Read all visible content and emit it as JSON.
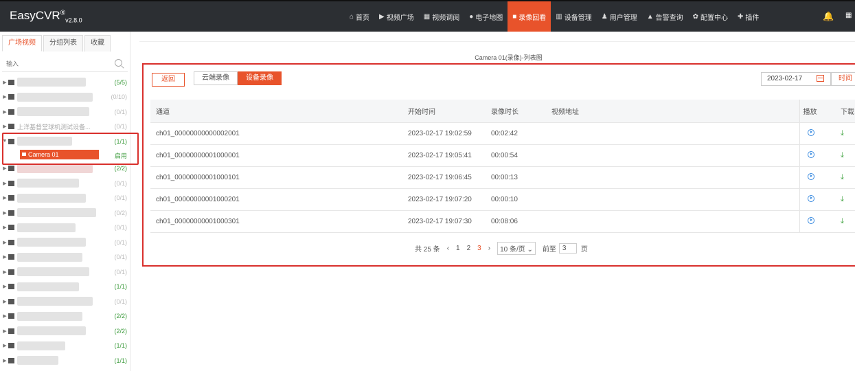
{
  "app": {
    "logo": "EasyCVR",
    "logo_sup": "®",
    "logo_version": "v2.8.0"
  },
  "nav": [
    {
      "label": "首页",
      "icon": "⌂"
    },
    {
      "label": "视频广场",
      "icon": "▶"
    },
    {
      "label": "视频调阅",
      "icon": "▦"
    },
    {
      "label": "电子地图",
      "icon": "●"
    },
    {
      "label": "录像回看",
      "icon": "■"
    },
    {
      "label": "设备管理",
      "icon": "▥"
    },
    {
      "label": "用户管理",
      "icon": "♟"
    },
    {
      "label": "告警查询",
      "icon": "▲"
    },
    {
      "label": "配置中心",
      "icon": "✿"
    },
    {
      "label": "插件",
      "icon": "✚"
    }
  ],
  "left": {
    "tabs": [
      "广场视频",
      "分组列表",
      "收藏"
    ],
    "search_placeholder": "输入",
    "tree_counts": [
      "(5/5)",
      "(0/10)",
      "(0/1)",
      "(0/1)",
      "(1/1)"
    ],
    "row4_name": "上洋基督堂球机测试设备...",
    "camera_name": "Camera 01",
    "camera_status": "启用",
    "tree_counts_after": [
      "(2/2)",
      "(0/1)",
      "(0/1)",
      "(0/2)",
      "(0/1)",
      "(0/1)",
      "(0/1)",
      "(0/1)",
      "(1/1)",
      "(0/1)",
      "(2/2)",
      "(2/2)",
      "(1/1)",
      "(1/1)"
    ]
  },
  "main": {
    "title": "Camera 01(录像)-列表图",
    "back_label": "返回",
    "cloud_label": "云端录像",
    "device_label": "设备录像",
    "date": "2023-02-17",
    "time_label": "时间",
    "columns": {
      "channel": "通道",
      "start": "开始时间",
      "duration": "录像时长",
      "url": "视频地址",
      "play": "播放",
      "download": "下载"
    },
    "rows": [
      {
        "channel": "ch01_00000000000002001",
        "start": "2023-02-17 19:02:59",
        "duration": "00:02:42"
      },
      {
        "channel": "ch01_00000000001000001",
        "start": "2023-02-17 19:05:41",
        "duration": "00:00:54"
      },
      {
        "channel": "ch01_00000000001000101",
        "start": "2023-02-17 19:06:45",
        "duration": "00:00:13"
      },
      {
        "channel": "ch01_00000000001000201",
        "start": "2023-02-17 19:07:20",
        "duration": "00:00:10"
      },
      {
        "channel": "ch01_00000000001000301",
        "start": "2023-02-17 19:07:30",
        "duration": "00:08:06"
      }
    ],
    "pager": {
      "total": "共 25 条",
      "prev": "‹",
      "p1": "1",
      "p2": "2",
      "p3": "3",
      "next": "›",
      "size": "10 条/页 ⌄",
      "goto": "前至",
      "page_input": "3",
      "page_unit": "页"
    }
  }
}
